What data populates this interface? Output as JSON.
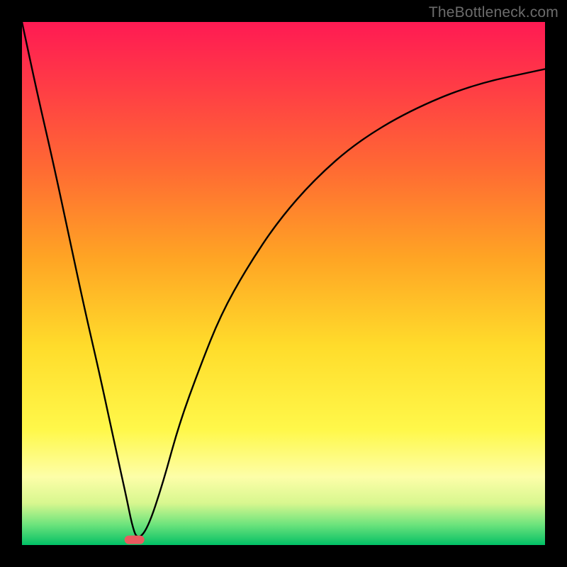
{
  "watermark": "TheBottleneck.com",
  "chart_data": {
    "type": "line",
    "title": "",
    "xlabel": "",
    "ylabel": "",
    "xlim": [
      0,
      100
    ],
    "ylim": [
      0,
      100
    ],
    "note": "Axes are unlabeled; x/y in percent of plot width/height (y=0 at bottom).",
    "series": [
      {
        "name": "curve",
        "x": [
          0,
          3,
          6,
          9,
          12,
          15,
          18,
          20,
          21,
          22,
          24,
          27,
          30,
          34,
          38,
          43,
          49,
          56,
          64,
          74,
          86,
          100
        ],
        "y": [
          100,
          86,
          73,
          59,
          45,
          32,
          18,
          9,
          4,
          1,
          3,
          12,
          23,
          34,
          44,
          53,
          62,
          70,
          77,
          83,
          88,
          91
        ]
      }
    ],
    "marker": {
      "x": 21.5,
      "y": 1.0,
      "color": "#ea5a5f",
      "shape": "pill"
    },
    "background_gradient": {
      "direction": "vertical",
      "stops": [
        {
          "pos": 0.0,
          "color": "#ff1a53"
        },
        {
          "pos": 0.28,
          "color": "#ff6a33"
        },
        {
          "pos": 0.62,
          "color": "#ffdc2b"
        },
        {
          "pos": 0.87,
          "color": "#fdfea8"
        },
        {
          "pos": 0.99,
          "color": "#1fc96b"
        },
        {
          "pos": 1.0,
          "color": "#00c267"
        }
      ]
    }
  }
}
